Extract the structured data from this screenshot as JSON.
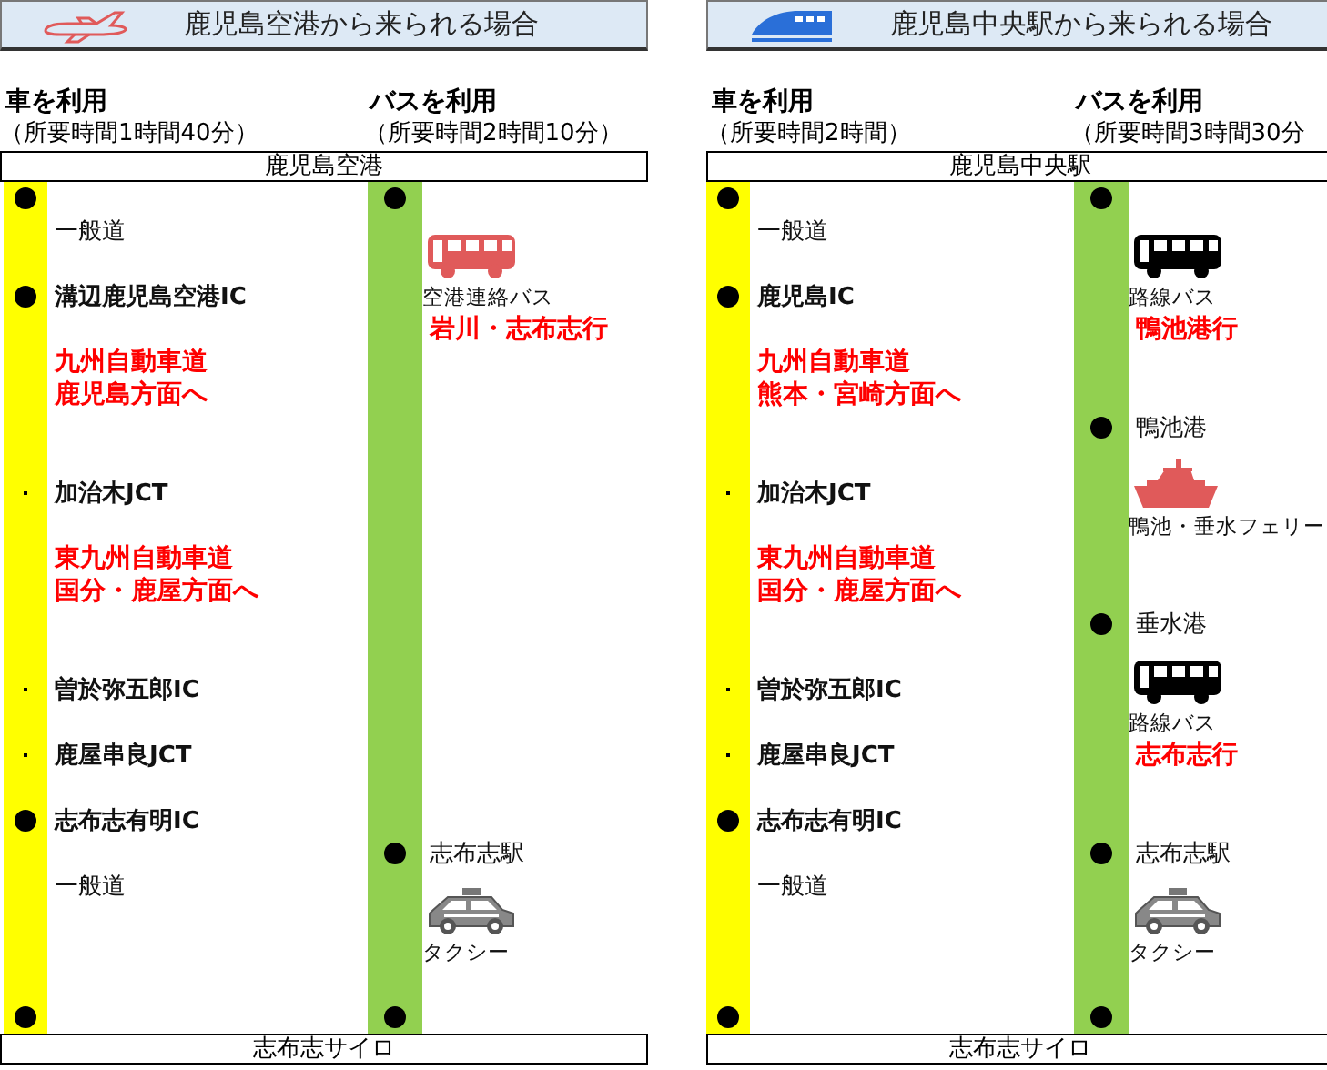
{
  "panels": [
    {
      "header": {
        "title": "鹿児島空港から来られる場合"
      },
      "origin": "鹿児島空港",
      "destination": "志布志サイロ",
      "columns": [
        {
          "kind": "car",
          "mode": "車を利用",
          "duration": "（所要時間1時間40分）",
          "items": [
            {
              "kind": "stop"
            },
            {
              "kind": "road",
              "text": "一般道"
            },
            {
              "kind": "stop",
              "text": "溝辺鹿児島空港IC"
            },
            {
              "kind": "direction",
              "lines": [
                "九州自動車道",
                "鹿児島方面へ"
              ]
            },
            {
              "kind": "junction",
              "text": "加治木JCT"
            },
            {
              "kind": "direction",
              "lines": [
                "東九州自動車道",
                "国分・鹿屋方面へ"
              ]
            },
            {
              "kind": "junction",
              "text": "曽於弥五郎IC"
            },
            {
              "kind": "junction",
              "text": "鹿屋串良JCT"
            },
            {
              "kind": "stop",
              "text": "志布志有明IC"
            },
            {
              "kind": "road",
              "text": "一般道"
            },
            {
              "kind": "stop"
            }
          ]
        },
        {
          "kind": "bus",
          "mode": "バスを利用",
          "duration": "（所要時間2時間10分）",
          "items": [
            {
              "kind": "stop"
            },
            {
              "kind": "transport",
              "text": "空港連絡バス"
            },
            {
              "kind": "destination",
              "text": "岩川・志布志行"
            },
            {
              "kind": "stop",
              "text": "志布志駅"
            },
            {
              "kind": "transport",
              "text": "タクシー"
            },
            {
              "kind": "stop"
            }
          ]
        }
      ]
    },
    {
      "header": {
        "title": "鹿児島中央駅から来られる場合"
      },
      "origin": "鹿児島中央駅",
      "destination": "志布志サイロ",
      "columns": [
        {
          "kind": "car",
          "mode": "車を利用",
          "duration": "（所要時間2時間）",
          "items": [
            {
              "kind": "stop"
            },
            {
              "kind": "road",
              "text": "一般道"
            },
            {
              "kind": "stop",
              "text": "鹿児島IC"
            },
            {
              "kind": "direction",
              "lines": [
                "九州自動車道",
                "熊本・宮崎方面へ"
              ]
            },
            {
              "kind": "junction",
              "text": "加治木JCT"
            },
            {
              "kind": "direction",
              "lines": [
                "東九州自動車道",
                "国分・鹿屋方面へ"
              ]
            },
            {
              "kind": "junction",
              "text": "曽於弥五郎IC"
            },
            {
              "kind": "junction",
              "text": "鹿屋串良JCT"
            },
            {
              "kind": "stop",
              "text": "志布志有明IC"
            },
            {
              "kind": "road",
              "text": "一般道"
            },
            {
              "kind": "stop"
            }
          ]
        },
        {
          "kind": "bus",
          "mode": "バスを利用",
          "duration": "（所要時間3時間30分",
          "items": [
            {
              "kind": "stop"
            },
            {
              "kind": "transport",
              "text": "路線バス"
            },
            {
              "kind": "destination",
              "text": "鴨池港行"
            },
            {
              "kind": "stop",
              "text": "鴨池港"
            },
            {
              "kind": "transport",
              "text": "鴨池・垂水フェリー"
            },
            {
              "kind": "stop",
              "text": "垂水港"
            },
            {
              "kind": "transport",
              "text": "路線バス"
            },
            {
              "kind": "destination",
              "text": "志布志行"
            },
            {
              "kind": "stop",
              "text": "志布志駅"
            },
            {
              "kind": "transport",
              "text": "タクシー"
            },
            {
              "kind": "stop"
            }
          ]
        }
      ]
    }
  ]
}
